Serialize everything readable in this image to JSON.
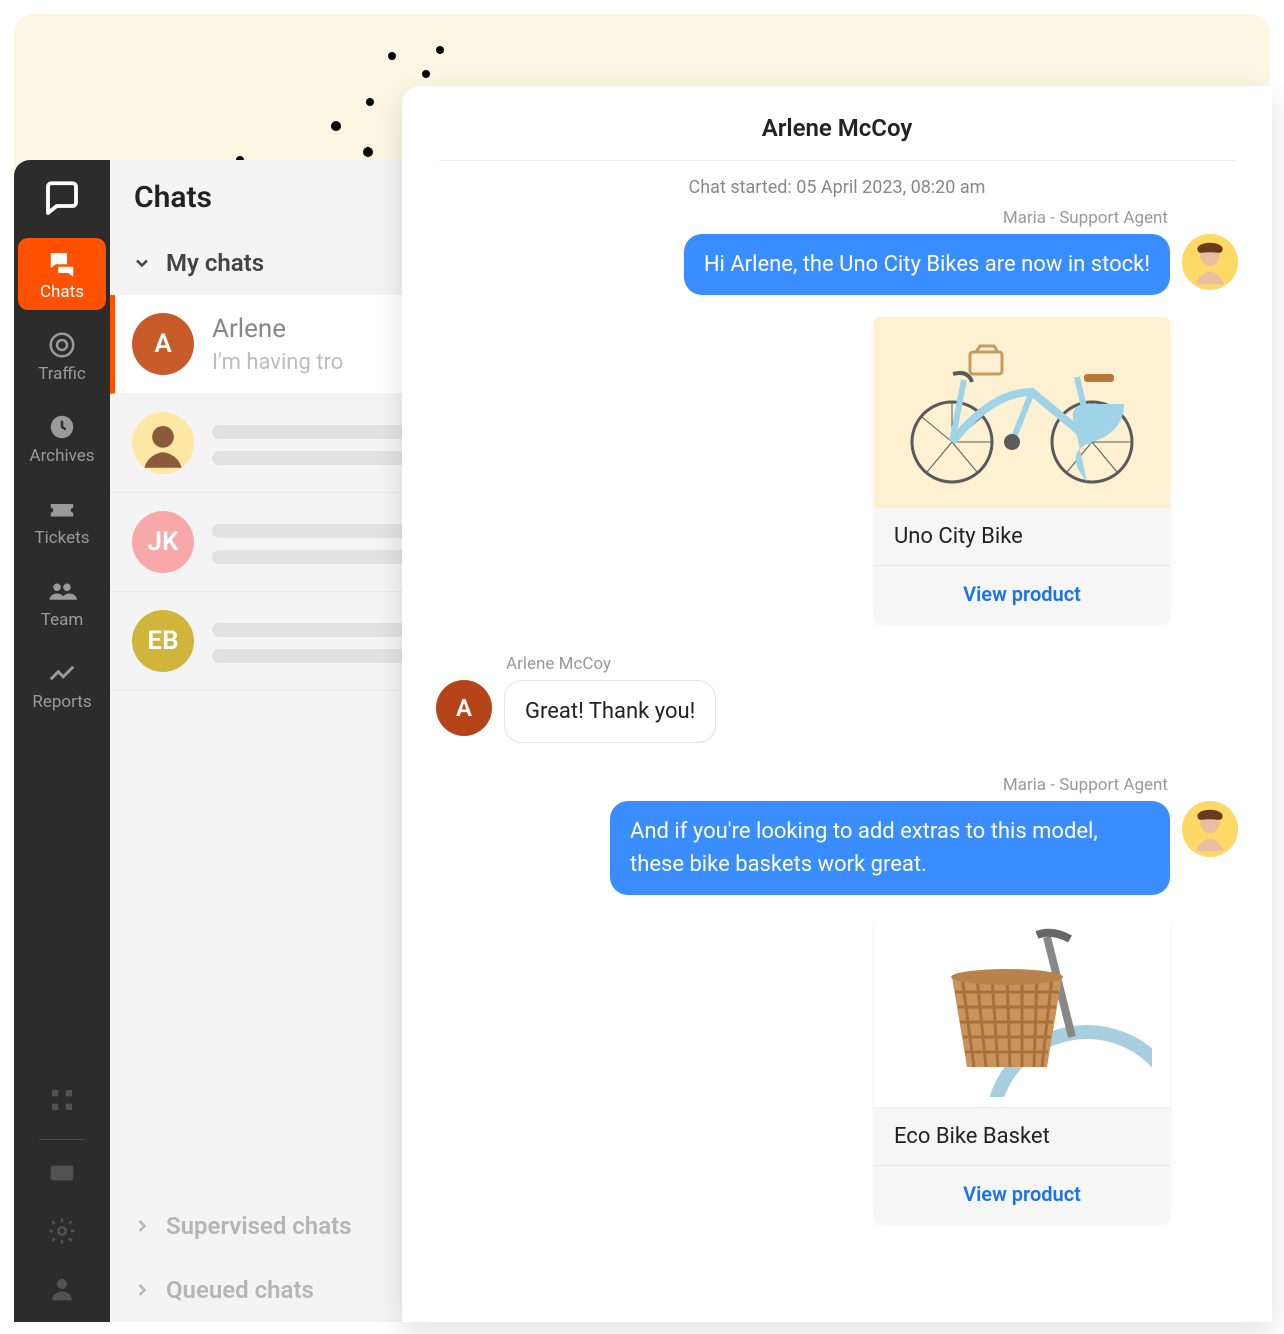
{
  "colors": {
    "primary": "#ff5100",
    "agentBubble": "#3a8dff",
    "link": "#1a73e8"
  },
  "sidebar": {
    "logo": "chat-bubble-logo",
    "items": [
      {
        "icon": "chats-icon",
        "label": "Chats",
        "active": true
      },
      {
        "icon": "traffic-icon",
        "label": "Traffic",
        "active": false
      },
      {
        "icon": "archives-icon",
        "label": "Archives",
        "active": false
      },
      {
        "icon": "tickets-icon",
        "label": "Tickets",
        "active": false
      },
      {
        "icon": "team-icon",
        "label": "Team",
        "active": false
      },
      {
        "icon": "reports-icon",
        "label": "Reports",
        "active": false
      }
    ]
  },
  "chatList": {
    "title": "Chats",
    "sections": {
      "myChats": {
        "label": "My chats",
        "expanded": true
      },
      "supervised": {
        "label": "Supervised chats",
        "expanded": false
      },
      "queued": {
        "label": "Queued chats",
        "expanded": false
      }
    },
    "rows": [
      {
        "name": "Arlene",
        "preview": "I'm having tro",
        "avatarColor": "#c85b2a",
        "initials": "A",
        "active": true
      },
      {
        "name": "",
        "preview": "",
        "avatarColor": "#ffe8a3",
        "initials": "",
        "isFace": true
      },
      {
        "name": "",
        "preview": "",
        "avatarColor": "#f7a9a9",
        "initials": "JK"
      },
      {
        "name": "",
        "preview": "",
        "avatarColor": "#d1b43c",
        "initials": "EB"
      }
    ]
  },
  "chat": {
    "headerName": "Arlene McCoy",
    "startedText": "Chat started: 05 April 2023, 08:20 am",
    "agent": {
      "name": "Maria - Support Agent",
      "avatarColor": "#ffd966"
    },
    "customer": {
      "name": "Arlene McCoy",
      "avatarColor": "#b54518",
      "initials": "A"
    },
    "messages": [
      {
        "from": "agent",
        "text": "Hi Arlene, the Uno City Bikes are now in stock!"
      },
      {
        "from": "agent",
        "type": "product",
        "title": "Uno City Bike",
        "action": "View product",
        "imageBg": "#fdf1d2"
      },
      {
        "from": "customer",
        "text": "Great! Thank you!"
      },
      {
        "from": "agent",
        "text": "And if you're looking to add extras to this model, these bike baskets work great."
      },
      {
        "from": "agent",
        "type": "product",
        "title": "Eco Bike Basket",
        "action": "View product",
        "imageBg": "#ffffff"
      }
    ]
  }
}
